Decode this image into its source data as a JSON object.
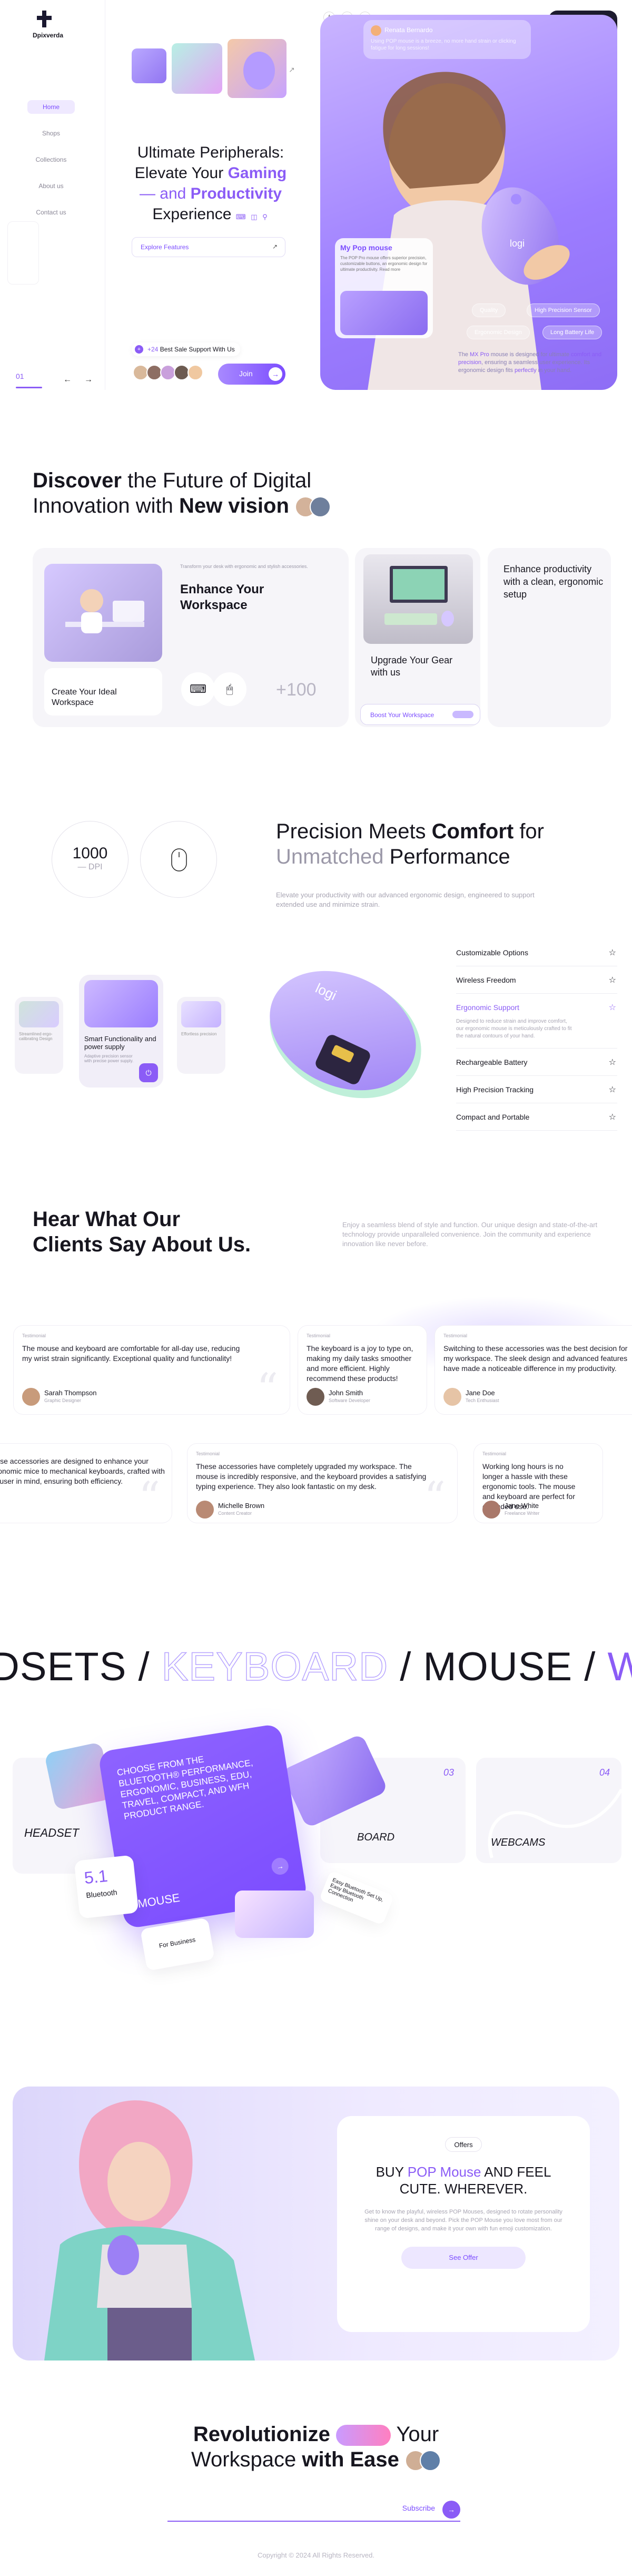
{
  "brand": {
    "name": "Dpixverda"
  },
  "nav": [
    "Home",
    "Shops",
    "Collections",
    "About us",
    "Contact us"
  ],
  "slider": {
    "number": "01",
    "prev": "←",
    "next": "→"
  },
  "hero": {
    "title_l1": "Ultimate Peripherals:",
    "title_l2a": "Elevate Your ",
    "title_l2b": "Gaming",
    "title_l3a": "— and ",
    "title_l3b": "Productivity",
    "title_l4": "Experience",
    "explore": "Explore Features",
    "explore_arrow": "↗",
    "support_badge": "+24",
    "support_label": "Best Sale Support With Us",
    "join": "Join",
    "join_arrow": "→"
  },
  "social": [
    "f",
    "𝕏",
    "◎"
  ],
  "signup": "Sign up",
  "review_card": {
    "name": "Renata Bernardo",
    "text": "Using POP mouse is a breeze, no more hand strain or clicking fatigue for long sessions!"
  },
  "mypop": {
    "title": "My Pop mouse",
    "desc": "The POP Pro mouse offers superior precision, customizable buttons, an ergonomic design for ultimate productivity. Read more"
  },
  "tags": [
    "Quality",
    "High Precision Sensor",
    "Ergonomic Design",
    "Long Battery Life"
  ],
  "hero_desc_pre": "The ",
  "hero_desc_link": "MX Pro",
  "hero_desc_mid": " mouse is designed for ultimate ",
  "hero_desc_c": "comfort and precision",
  ", ": "",
  "hero_desc_rest": ", ensuring a seamless user experience. Its ergonomic design fits ",
  "hero_desc_p": "perfectly",
  "hero_desc_end": " in your hand.",
  "discover": {
    "t1a": "Discover",
    "t1b": " the Future of Digital",
    "t2a": "Innovation with ",
    "t2b": "New vision",
    "card1_label": "Create Your Ideal Workspace",
    "card2_small": "Transform your desk with ergonomic and stylish accessories.",
    "card2_title": "Enhance Your Workspace",
    "card2_count": "+100",
    "card3_label": "Upgrade Your Gear with us",
    "card3_btn": "Boost Your Workspace",
    "card4_title": "Enhance productivity with a clean, ergonomic setup"
  },
  "precision": {
    "dpi_val": "1000",
    "dpi_label": "— DPI",
    "t1a": "Precision Meets ",
    "t1b": "Comfort",
    "t1c": " for",
    "t2a": "Unmatched",
    "t2b": " Performance",
    "desc": "Elevate your productivity with our advanced ergonomic design, engineered to support extended use and minimize strain.",
    "mini1_title": "Streamlined ergo-calibrating Design",
    "mini2_title": "Smart Functionality and power supply",
    "mini2_desc": "Adaptive precision sensor with precise power supply.",
    "mini3_title": "Effortless precision",
    "features": [
      "Customizable Options",
      "Wireless Freedom",
      "Ergonomic Support",
      "Rechargeable Battery",
      "High Precision Tracking",
      "Compact and Portable"
    ],
    "feature_active_desc": "Designed to reduce strain and improve comfort, our ergonomic mouse is meticulously crafted to fit the natural contours of your hand.",
    "star": "☆"
  },
  "clients": {
    "t1": "Hear What Our",
    "t2": "Clients Say About Us.",
    "desc": "Enjoy a seamless blend of style and function. Our unique design and state-of-the-art technology provide unparalleled convenience. Join the community and experience innovation like never before.",
    "testimonials": [
      {
        "src": "Testimonial",
        "q": "The mouse and keyboard are comfortable for all-day use, reducing my wrist strain significantly. Exceptional quality and functionality!",
        "name": "Sarah Thompson",
        "role": "Graphic Designer"
      },
      {
        "src": "Testimonial",
        "q": "The keyboard is a joy to type on, making my daily tasks smoother and more efficient. Highly recommend these products!",
        "name": "John Smith",
        "role": "Software Developer"
      },
      {
        "src": "Testimonial",
        "q": "Switching to these accessories was the best decision for my workspace. The sleek design and advanced features have made a noticeable difference in my productivity.",
        "name": "Jane Doe",
        "role": "Tech Enthusiast"
      },
      {
        "src": "Testimonial",
        "q": "These accessories are designed to enhance your ergonomic mice to mechanical keyboards, crafted with the user in mind, ensuring both efficiency.",
        "name": "",
        "role": ""
      },
      {
        "src": "Testimonial",
        "q": "These accessories have completely upgraded my workspace. The mouse is incredibly responsive, and the keyboard provides a satisfying typing experience. They also look fantastic on my desk.",
        "name": "Michelle Brown",
        "role": "Content Creator"
      },
      {
        "src": "Testimonial",
        "q": "Working long hours is no longer a hassle with these ergonomic tools. The mouse and keyboard are perfect for extended use.",
        "name": "Jane White",
        "role": "Freelance Writer"
      }
    ],
    "quote": "“"
  },
  "cats": {
    "m1": "DSETS / ",
    "m2": "KEYBOARD",
    "m3": " / MOUSE / ",
    "m4": "WEB",
    "promo": "CHOOSE FROM THE BLUETOOTH® PERFORMANCE, ERGONOMIC, BUSINESS, EDU, TRAVEL, COMPACT, AND WFH PRODUCT RANGE.",
    "promo_label": "MOUSE",
    "headset": "HEADSET",
    "keyboard": "BOARD",
    "webcams": "WEBCAMS",
    "n3": "03",
    "n4": "04",
    "bt_val": "5.1",
    "bt_label": "Bluetooth",
    "chip1": "Easy Bluetooth Set Up, Easy Bluetooth Connection",
    "chip2": "For Business"
  },
  "offer": {
    "badge": "Offers",
    "t_a": "BUY ",
    "t_b": "POP Mouse",
    "t_c": " AND FEEL CUTE. WHEREVER.",
    "desc": "Get to know the playful, wireless POP Mouses, designed to rotate personality shine on your desk and beyond. Pick the POP Mouse you love most from our range of designs, and make it your own with fun emoji customization.",
    "btn": "See Offer"
  },
  "footer": {
    "t1a": "Revolutionize ",
    "t1b": " Your",
    "t2a": "Workspace ",
    "t2b": "with Ease",
    "subscribe": "Subscribe",
    "sub_arrow": "→",
    "copy": "Copyright © 2024 All Rights Reserved."
  }
}
